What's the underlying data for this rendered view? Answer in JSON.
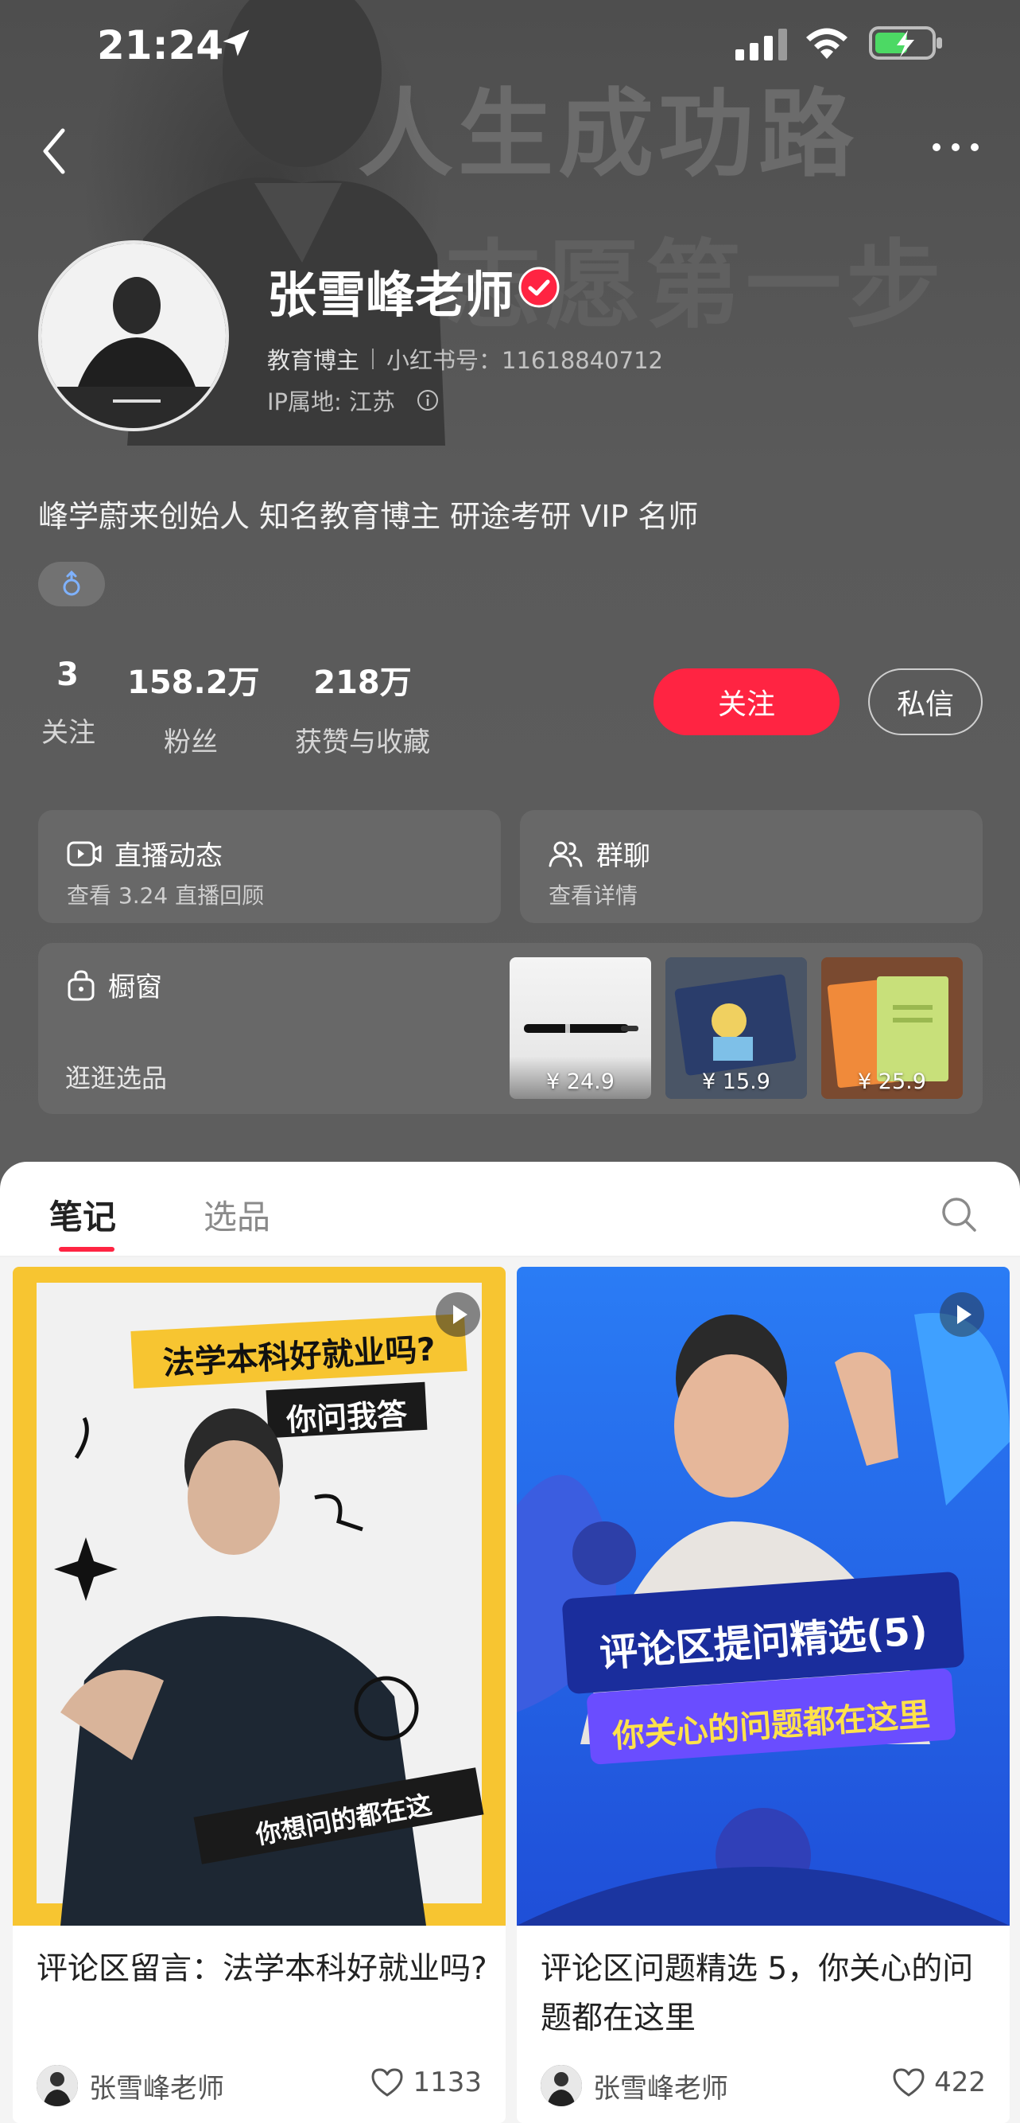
{
  "status_bar": {
    "time": "21:24"
  },
  "profile": {
    "name": "张雪峰老师",
    "category": "教育博主",
    "red_id": "小红书号：11618840712",
    "ip_location": "IP属地: 江苏",
    "bio": "峰学蔚来创始人 知名教育博主 研途考研 VIP 名师",
    "background_text": [
      "人生成功路",
      "志愿第一步"
    ]
  },
  "stats": [
    {
      "value": "3",
      "label": "关注"
    },
    {
      "value": "158.2万",
      "label": "粉丝"
    },
    {
      "value": "218万",
      "label": "获赞与收藏"
    }
  ],
  "actions": {
    "follow": "关注",
    "message": "私信"
  },
  "cards": {
    "live": {
      "title": "直播动态",
      "subtitle": "查看 3.24 直播回顾"
    },
    "group": {
      "title": "群聊",
      "subtitle": "查看详情"
    },
    "shop": {
      "title": "橱窗",
      "subtitle": "逛逛选品",
      "items": [
        {
          "price": "¥ 24.9"
        },
        {
          "price": "¥ 15.9"
        },
        {
          "price": "¥ 25.9"
        }
      ]
    }
  },
  "tabs": [
    {
      "label": "笔记",
      "active": true
    },
    {
      "label": "选品",
      "active": false
    }
  ],
  "notes": [
    {
      "cover_headline": "法学本科好就业吗?",
      "cover_sub": "你问我答",
      "cover_tag": "你想问的都在这",
      "title": "评论区留言：法学本科好就业吗?",
      "author": "张雪峰老师",
      "likes": "1133"
    },
    {
      "cover_headline": "评论区提问精选(5)",
      "cover_sub": "你关心的问题都在这里",
      "title": "评论区问题精选 5，你关心的问题都在这里",
      "author": "张雪峰老师",
      "likes": "422"
    }
  ],
  "colors": {
    "accent": "#ff2442",
    "header_bg": "#5c5c5c",
    "card_bg": "#686868"
  }
}
